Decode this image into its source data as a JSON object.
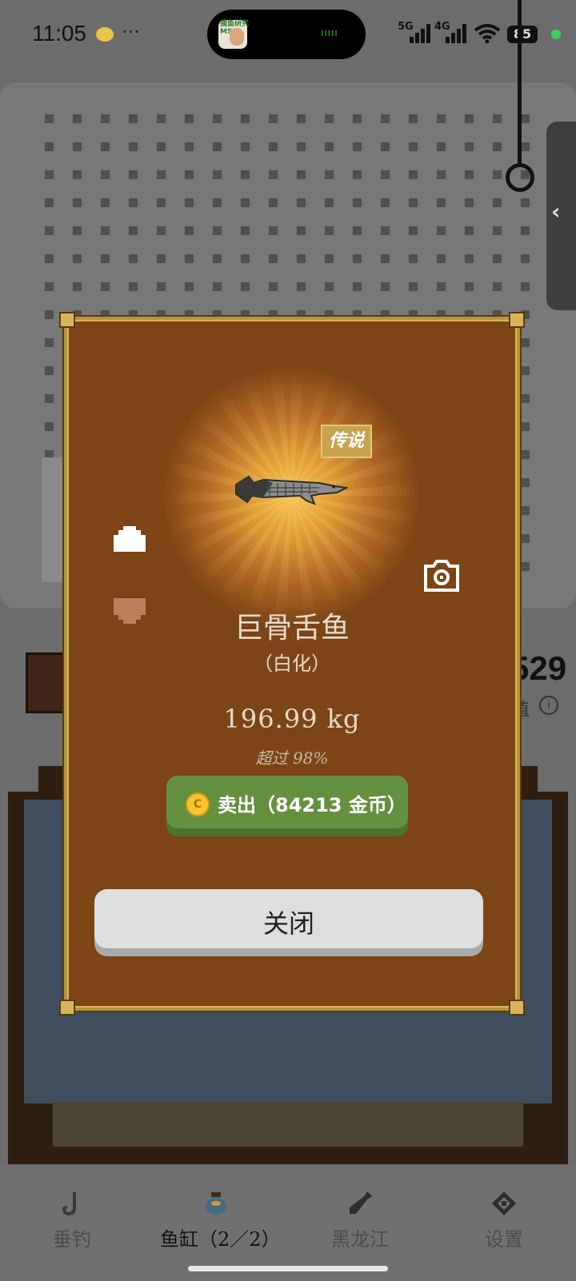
{
  "status_bar": {
    "time": "11:05",
    "more": "···",
    "app_icon_text": "捕鱼研究\nMSB",
    "island_bars": "ııııı",
    "net_5g": "5G",
    "net_4g": "4G",
    "battery": "85"
  },
  "background": {
    "number": "529",
    "sub_label": "值",
    "info_icon": "i",
    "side_tab_icon": "‹"
  },
  "modal": {
    "rarity": "传说",
    "fish_name": "巨骨舌鱼",
    "variant": "（白化）",
    "weight": "196.99 kg",
    "percentile": "超过 98%",
    "sell_button": "卖出（84213 金币）",
    "coin_symbol": "C",
    "close_button": "关闭",
    "icons": [
      "arrow-up-icon",
      "arrow-down-icon",
      "camera-icon"
    ]
  },
  "bottom_nav": {
    "items": [
      {
        "label": "垂钓",
        "icon": "fishing-hook-icon",
        "active": false
      },
      {
        "label": "鱼缸（2／2）",
        "icon": "fish-bowl-icon",
        "active": true
      },
      {
        "label": "黑龙江",
        "icon": "bottle-icon",
        "active": false
      },
      {
        "label": "设置",
        "icon": "settings-icon",
        "active": false
      }
    ]
  },
  "colors": {
    "modal_bg": "#7d4415",
    "modal_border": "#b8943c",
    "sell_green": "#649040",
    "close_gray": "#dedede",
    "rarity_gold": "#c9a24d"
  }
}
